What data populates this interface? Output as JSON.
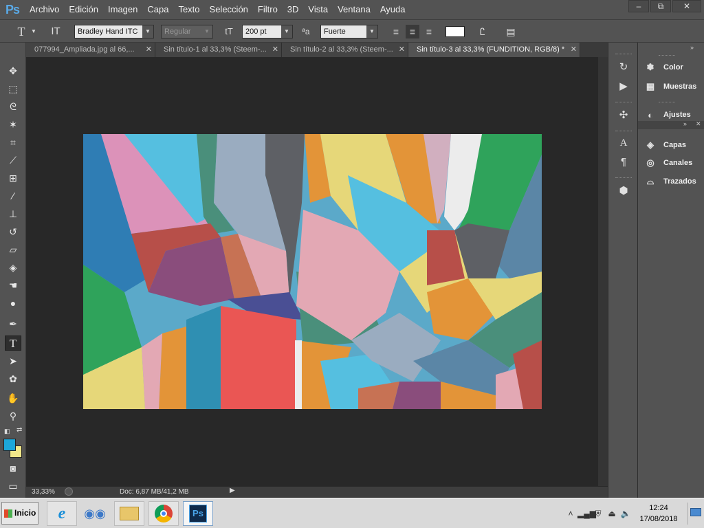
{
  "app": {
    "logo": "Ps",
    "accent_color": "#5aa9e6"
  },
  "menu": [
    "Archivo",
    "Edición",
    "Imagen",
    "Capa",
    "Texto",
    "Selección",
    "Filtro",
    "3D",
    "Vista",
    "Ventana",
    "Ayuda"
  ],
  "window_controls": {
    "minimize": "–",
    "restore": "⧉",
    "close": "✕"
  },
  "options": {
    "tool_icon": "T",
    "font_family": "Bradley Hand ITC",
    "font_style": "Regular",
    "font_size": "200 pt",
    "antialias_label": "ªa",
    "antialias": "Fuerte",
    "text_color": "#ffffff"
  },
  "tabs": [
    {
      "label": "077994_Ampliada.jpg al 66,...",
      "active": false
    },
    {
      "label": "Sin título-1 al 33,3% (Steem-...",
      "active": false
    },
    {
      "label": "Sin título-2 al 33,3% (Steem-...",
      "active": false
    },
    {
      "label": "Sin título-3 al 33,3% (FUNDITION, RGB/8) *",
      "active": true
    }
  ],
  "status": {
    "zoom": "33,33%",
    "doc": "Doc: 6,87 MB/41,2 MB"
  },
  "colors": {
    "foreground": "#1da7d9",
    "background": "#f2e88a"
  },
  "tools": [
    "move-icon",
    "marquee-icon",
    "lasso-icon",
    "magic-wand-icon",
    "crop-icon",
    "eyedropper-icon",
    "healing-brush-icon",
    "brush-icon",
    "clone-stamp-icon",
    "history-brush-icon",
    "eraser-icon",
    "paint-bucket-icon",
    "smudge-icon",
    "dodge-icon",
    "pen-icon",
    "type-icon",
    "path-select-icon",
    "shape-icon",
    "hand-icon",
    "zoom-icon"
  ],
  "panels": {
    "top": [
      {
        "label": "Color",
        "icon": "palette-icon"
      },
      {
        "label": "Muestras",
        "icon": "grid-icon"
      }
    ],
    "mid": [
      {
        "label": "Ajustes",
        "icon": "adjust-icon"
      }
    ],
    "bottom": [
      {
        "label": "Capas",
        "icon": "layers-icon"
      },
      {
        "label": "Canales",
        "icon": "channels-icon"
      },
      {
        "label": "Trazados",
        "icon": "paths-icon"
      }
    ]
  },
  "taskbar": {
    "start_label": "Inicio",
    "apps": [
      "ie-icon",
      "eyes-icon",
      "folder-icon",
      "chrome-icon",
      "photoshop-icon"
    ],
    "time": "12:24",
    "date": "17/08/2018"
  }
}
